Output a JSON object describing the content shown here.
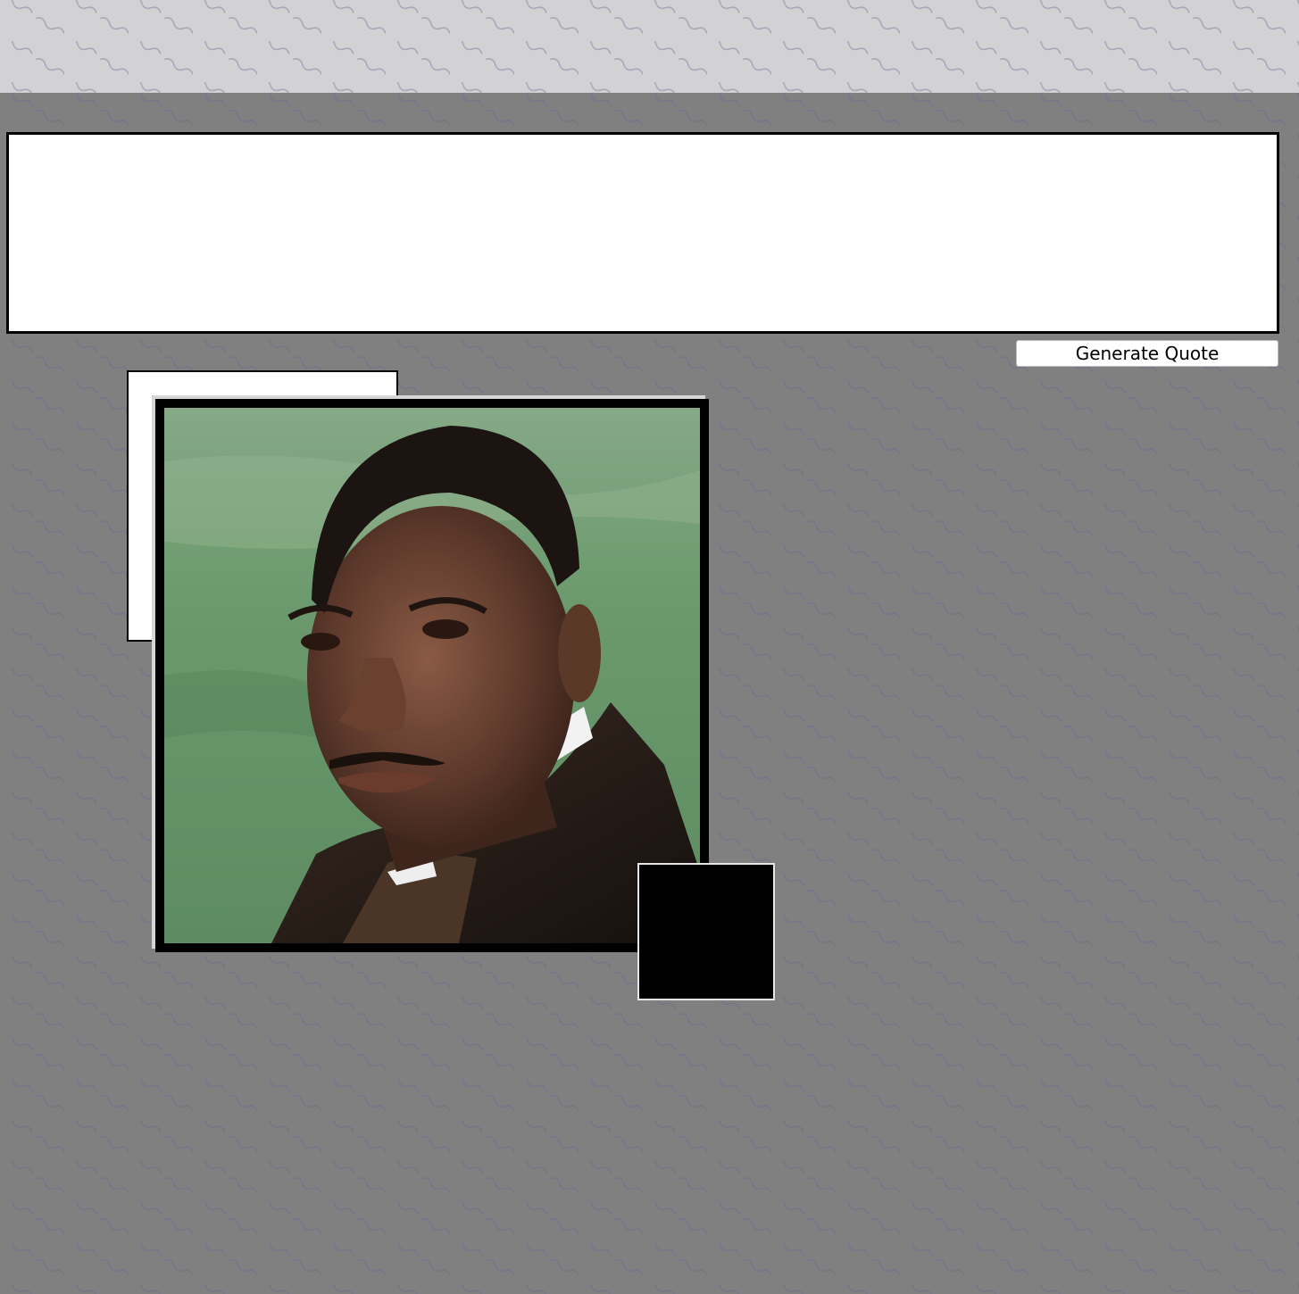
{
  "header": {},
  "quote": {
    "text": ""
  },
  "controls": {
    "generate_label": "Generate Quote"
  },
  "portrait": {
    "subject_icon": "portrait-photo"
  },
  "colors": {
    "page_background": "#808080",
    "header_background": "#d2d2d4",
    "button_background": "#ffffff",
    "frame": "#000000"
  }
}
